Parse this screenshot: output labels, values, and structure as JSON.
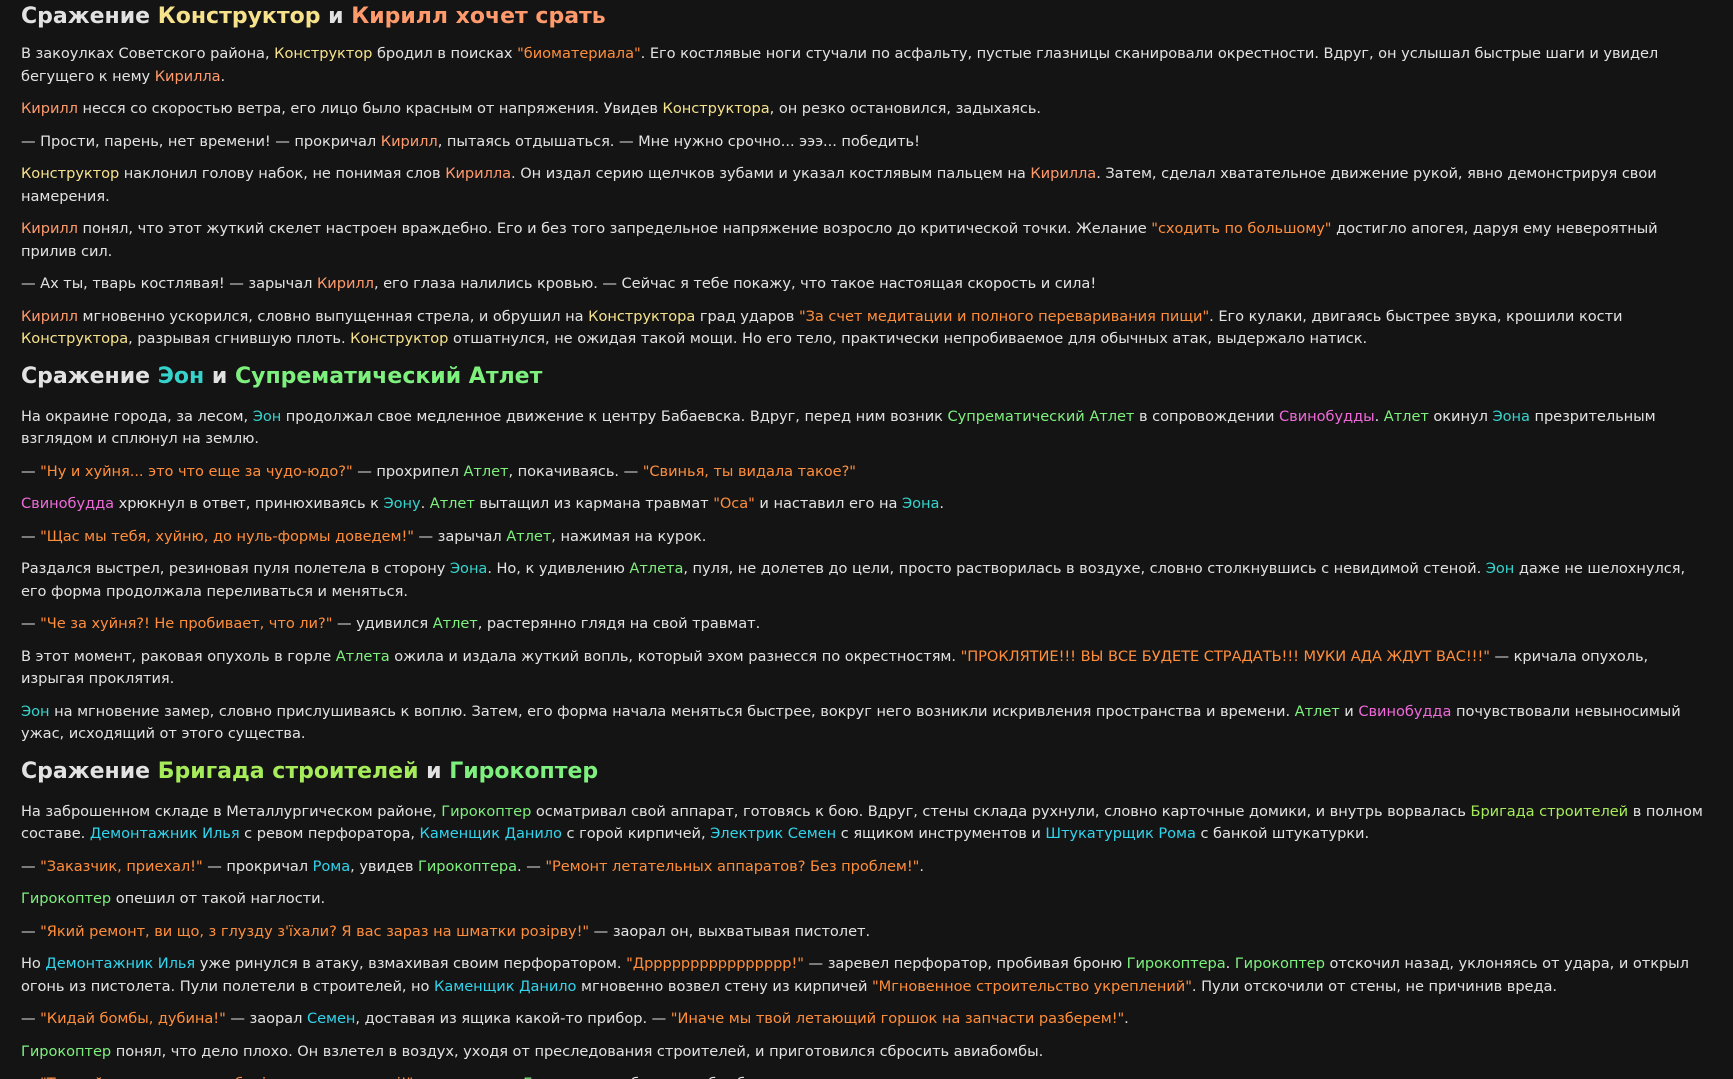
{
  "colors": {
    "background": "#141414",
    "text": "#e2e2e2",
    "yellow": "#f7e28c",
    "salmon": "#ff9a6c",
    "orange": "#ff8e3c",
    "cyan": "#36d3cd",
    "green": "#7ef07e",
    "lime": "#a6ec5a",
    "pink": "#ee6ad9",
    "blue": "#32d4ec"
  },
  "sections": [
    {
      "heading": [
        {
          "t": "Сражение ",
          "c": "text"
        },
        {
          "t": "Конструктор",
          "c": "yellow"
        },
        {
          "t": " и ",
          "c": "text"
        },
        {
          "t": "Кирилл хочет срать",
          "c": "salmon"
        }
      ],
      "paragraphs": [
        [
          {
            "t": "В закоулках Советского района, "
          },
          {
            "t": "Конструктор",
            "c": "yellow"
          },
          {
            "t": " бродил в поисках "
          },
          {
            "t": "\"биоматериала\"",
            "c": "orange"
          },
          {
            "t": ". Его костлявые ноги стучали по асфальту, пустые глазницы сканировали окрестности. Вдруг, он услышал быстрые шаги и увидел бегущего к нему "
          },
          {
            "t": "Кирилла",
            "c": "salmon"
          },
          {
            "t": "."
          }
        ],
        [
          {
            "t": "Кирилл",
            "c": "salmon"
          },
          {
            "t": " несся со скоростью ветра, его лицо было красным от напряжения. Увидев "
          },
          {
            "t": "Конструктора",
            "c": "yellow"
          },
          {
            "t": ", он резко остановился, задыхаясь."
          }
        ],
        [
          {
            "t": "— Прости, парень, нет времени! — прокричал "
          },
          {
            "t": "Кирилл",
            "c": "salmon"
          },
          {
            "t": ", пытаясь отдышаться. — Мне нужно срочно... эээ... победить!"
          }
        ],
        [
          {
            "t": "Конструктор",
            "c": "yellow"
          },
          {
            "t": " наклонил голову набок, не понимая слов "
          },
          {
            "t": "Кирилла",
            "c": "salmon"
          },
          {
            "t": ". Он издал серию щелчков зубами и указал костлявым пальцем на "
          },
          {
            "t": "Кирилла",
            "c": "salmon"
          },
          {
            "t": ". Затем, сделал хватательное движение рукой, явно демонстрируя свои намерения."
          }
        ],
        [
          {
            "t": "Кирилл",
            "c": "salmon"
          },
          {
            "t": " понял, что этот жуткий скелет настроен враждебно. Его и без того запредельное напряжение возросло до критической точки. Желание "
          },
          {
            "t": "\"сходить по большому\"",
            "c": "orange"
          },
          {
            "t": " достигло апогея, даруя ему невероятный прилив сил."
          }
        ],
        [
          {
            "t": "— Ах ты, тварь костлявая! — зарычал "
          },
          {
            "t": "Кирилл",
            "c": "salmon"
          },
          {
            "t": ", его глаза налились кровью. — Сейчас я тебе покажу, что такое настоящая скорость и сила!"
          }
        ],
        [
          {
            "t": "Кирилл",
            "c": "salmon"
          },
          {
            "t": " мгновенно ускорился, словно выпущенная стрела, и обрушил на "
          },
          {
            "t": "Конструктора",
            "c": "yellow"
          },
          {
            "t": " град ударов "
          },
          {
            "t": "\"За счет медитации и полного переваривания пищи\"",
            "c": "orange"
          },
          {
            "t": ". Его кулаки, двигаясь быстрее звука, крошили кости "
          },
          {
            "t": "Конструктора",
            "c": "yellow"
          },
          {
            "t": ", разрывая сгнившую плоть. "
          },
          {
            "t": "Конструктор",
            "c": "yellow"
          },
          {
            "t": " отшатнулся, не ожидая такой мощи. Но его тело, практически непробиваемое для обычных атак, выдержало натиск."
          }
        ]
      ]
    },
    {
      "heading": [
        {
          "t": "Сражение ",
          "c": "text"
        },
        {
          "t": "Эон",
          "c": "cyan"
        },
        {
          "t": " и ",
          "c": "text"
        },
        {
          "t": "Супрематический Атлет",
          "c": "green"
        }
      ],
      "paragraphs": [
        [
          {
            "t": "На окраине города, за лесом, "
          },
          {
            "t": "Эон",
            "c": "cyan"
          },
          {
            "t": " продолжал свое медленное движение к центру Бабаевска. Вдруг, перед ним возник "
          },
          {
            "t": "Супрематический Атлет",
            "c": "green"
          },
          {
            "t": " в сопровождении "
          },
          {
            "t": "Свинобудды",
            "c": "pink"
          },
          {
            "t": ". "
          },
          {
            "t": "Атлет",
            "c": "green"
          },
          {
            "t": " окинул "
          },
          {
            "t": "Эона",
            "c": "cyan"
          },
          {
            "t": " презрительным взглядом и сплюнул на землю."
          }
        ],
        [
          {
            "t": "— "
          },
          {
            "t": "\"Ну и хуйня... это что еще за чудо-юдо?\"",
            "c": "orange"
          },
          {
            "t": " — прохрипел "
          },
          {
            "t": "Атлет",
            "c": "green"
          },
          {
            "t": ", покачиваясь. — "
          },
          {
            "t": "\"Свинья, ты видала такое?\"",
            "c": "orange"
          }
        ],
        [
          {
            "t": "Свинобудда",
            "c": "pink"
          },
          {
            "t": " хрюкнул в ответ, принюхиваясь к "
          },
          {
            "t": "Эону",
            "c": "cyan"
          },
          {
            "t": ". "
          },
          {
            "t": "Атлет",
            "c": "green"
          },
          {
            "t": " вытащил из кармана травмат "
          },
          {
            "t": "\"Оса\"",
            "c": "orange"
          },
          {
            "t": " и наставил его на "
          },
          {
            "t": "Эона",
            "c": "cyan"
          },
          {
            "t": "."
          }
        ],
        [
          {
            "t": "— "
          },
          {
            "t": "\"Щас мы тебя, хуйню, до нуль-формы доведем!\"",
            "c": "orange"
          },
          {
            "t": " — зарычал "
          },
          {
            "t": "Атлет",
            "c": "green"
          },
          {
            "t": ", нажимая на курок."
          }
        ],
        [
          {
            "t": "Раздался выстрел, резиновая пуля полетела в сторону "
          },
          {
            "t": "Эона",
            "c": "cyan"
          },
          {
            "t": ". Но, к удивлению "
          },
          {
            "t": "Атлета",
            "c": "green"
          },
          {
            "t": ", пуля, не долетев до цели, просто растворилась в воздухе, словно столкнувшись с невидимой стеной. "
          },
          {
            "t": "Эон",
            "c": "cyan"
          },
          {
            "t": " даже не шелохнулся, его форма продолжала переливаться и меняться."
          }
        ],
        [
          {
            "t": "— "
          },
          {
            "t": "\"Че за хуйня?! Не пробивает, что ли?\"",
            "c": "orange"
          },
          {
            "t": " — удивился "
          },
          {
            "t": "Атлет",
            "c": "green"
          },
          {
            "t": ", растерянно глядя на свой травмат."
          }
        ],
        [
          {
            "t": "В этот момент, раковая опухоль в горле "
          },
          {
            "t": "Атлета",
            "c": "green"
          },
          {
            "t": " ожила и издала жуткий вопль, который эхом разнесся по окрестностям. "
          },
          {
            "t": "\"ПРОКЛЯТИЕ!!! ВЫ ВСЕ БУДЕТЕ СТРАДАТЬ!!! МУКИ АДА ЖДУТ ВАС!!!\"",
            "c": "orange"
          },
          {
            "t": " — кричала опухоль, изрыгая проклятия."
          }
        ],
        [
          {
            "t": "Эон",
            "c": "cyan"
          },
          {
            "t": " на мгновение замер, словно прислушиваясь к воплю. Затем, его форма начала меняться быстрее, вокруг него возникли искривления пространства и времени. "
          },
          {
            "t": "Атлет",
            "c": "green"
          },
          {
            "t": " и "
          },
          {
            "t": "Свинобудда",
            "c": "pink"
          },
          {
            "t": " почувствовали невыносимый ужас, исходящий от этого существа."
          }
        ]
      ]
    },
    {
      "heading": [
        {
          "t": "Сражение ",
          "c": "text"
        },
        {
          "t": "Бригада строителей",
          "c": "lime"
        },
        {
          "t": " и ",
          "c": "text"
        },
        {
          "t": "Гирокоптер",
          "c": "green"
        }
      ],
      "paragraphs": [
        [
          {
            "t": "На заброшенном складе в Металлургическом районе, "
          },
          {
            "t": "Гирокоптер",
            "c": "green"
          },
          {
            "t": " осматривал свой аппарат, готовясь к бою. Вдруг, стены склада рухнули, словно карточные домики, и внутрь ворвалась "
          },
          {
            "t": "Бригада строителей",
            "c": "lime"
          },
          {
            "t": " в полном составе. "
          },
          {
            "t": "Демонтажник Илья",
            "c": "blue"
          },
          {
            "t": " с ревом перфоратора, "
          },
          {
            "t": "Каменщик Данило",
            "c": "blue"
          },
          {
            "t": " с горой кирпичей, "
          },
          {
            "t": "Электрик Семен",
            "c": "blue"
          },
          {
            "t": " с ящиком инструментов и "
          },
          {
            "t": "Штукатурщик Рома",
            "c": "blue"
          },
          {
            "t": " с банкой штукатурки."
          }
        ],
        [
          {
            "t": "— "
          },
          {
            "t": "\"Заказчик, приехал!\"",
            "c": "orange"
          },
          {
            "t": " — прокричал "
          },
          {
            "t": "Рома",
            "c": "blue"
          },
          {
            "t": ", увидев "
          },
          {
            "t": "Гирокоптера",
            "c": "green"
          },
          {
            "t": ". — "
          },
          {
            "t": "\"Ремонт летательных аппаратов? Без проблем!\"",
            "c": "orange"
          },
          {
            "t": "."
          }
        ],
        [
          {
            "t": "Гирокоптер",
            "c": "green"
          },
          {
            "t": " опешил от такой наглости."
          }
        ],
        [
          {
            "t": "— "
          },
          {
            "t": "\"Який ремонт, ви що, з глузду з'їхали? Я вас зараз на шматки розірву!\"",
            "c": "orange"
          },
          {
            "t": " — заорал он, выхватывая пистолет."
          }
        ],
        [
          {
            "t": "Но "
          },
          {
            "t": "Демонтажник Илья",
            "c": "blue"
          },
          {
            "t": " уже ринулся в атаку, взмахивая своим перфоратором. "
          },
          {
            "t": "\"Дрррррррррррррррр!\"",
            "c": "orange"
          },
          {
            "t": " — заревел перфоратор, пробивая броню "
          },
          {
            "t": "Гирокоптера",
            "c": "green"
          },
          {
            "t": ". "
          },
          {
            "t": "Гирокоптер",
            "c": "green"
          },
          {
            "t": " отскочил назад, уклоняясь от удара, и открыл огонь из пистолета. Пули полетели в строителей, но "
          },
          {
            "t": "Каменщик Данило",
            "c": "blue"
          },
          {
            "t": " мгновенно возвел стену из кирпичей "
          },
          {
            "t": "\"Мгновенное строительство укреплений\"",
            "c": "orange"
          },
          {
            "t": ". Пули отскочили от стены, не причинив вреда."
          }
        ],
        [
          {
            "t": "— "
          },
          {
            "t": "\"Кидай бомбы, дубина!\"",
            "c": "orange"
          },
          {
            "t": " — заорал "
          },
          {
            "t": "Семен",
            "c": "blue"
          },
          {
            "t": ", доставая из ящика какой-то прибор. — "
          },
          {
            "t": "\"Иначе мы твой летающий горшок на запчасти разберем!\"",
            "c": "orange"
          },
          {
            "t": "."
          }
        ],
        [
          {
            "t": "Гирокоптер",
            "c": "green"
          },
          {
            "t": " понял, что дело плохо. Он взлетел в воздух, уходя от преследования строителей, и приготовился сбросить авиабомбы."
          }
        ],
        [
          {
            "t": "— "
          },
          {
            "t": "\"Тримайте подаруночок, будівельники хренові!\"",
            "c": "orange"
          },
          {
            "t": " — прокричал "
          },
          {
            "t": "Гирокоптер",
            "c": "green"
          },
          {
            "t": ", сбрасывая бомбу."
          }
        ]
      ]
    }
  ]
}
